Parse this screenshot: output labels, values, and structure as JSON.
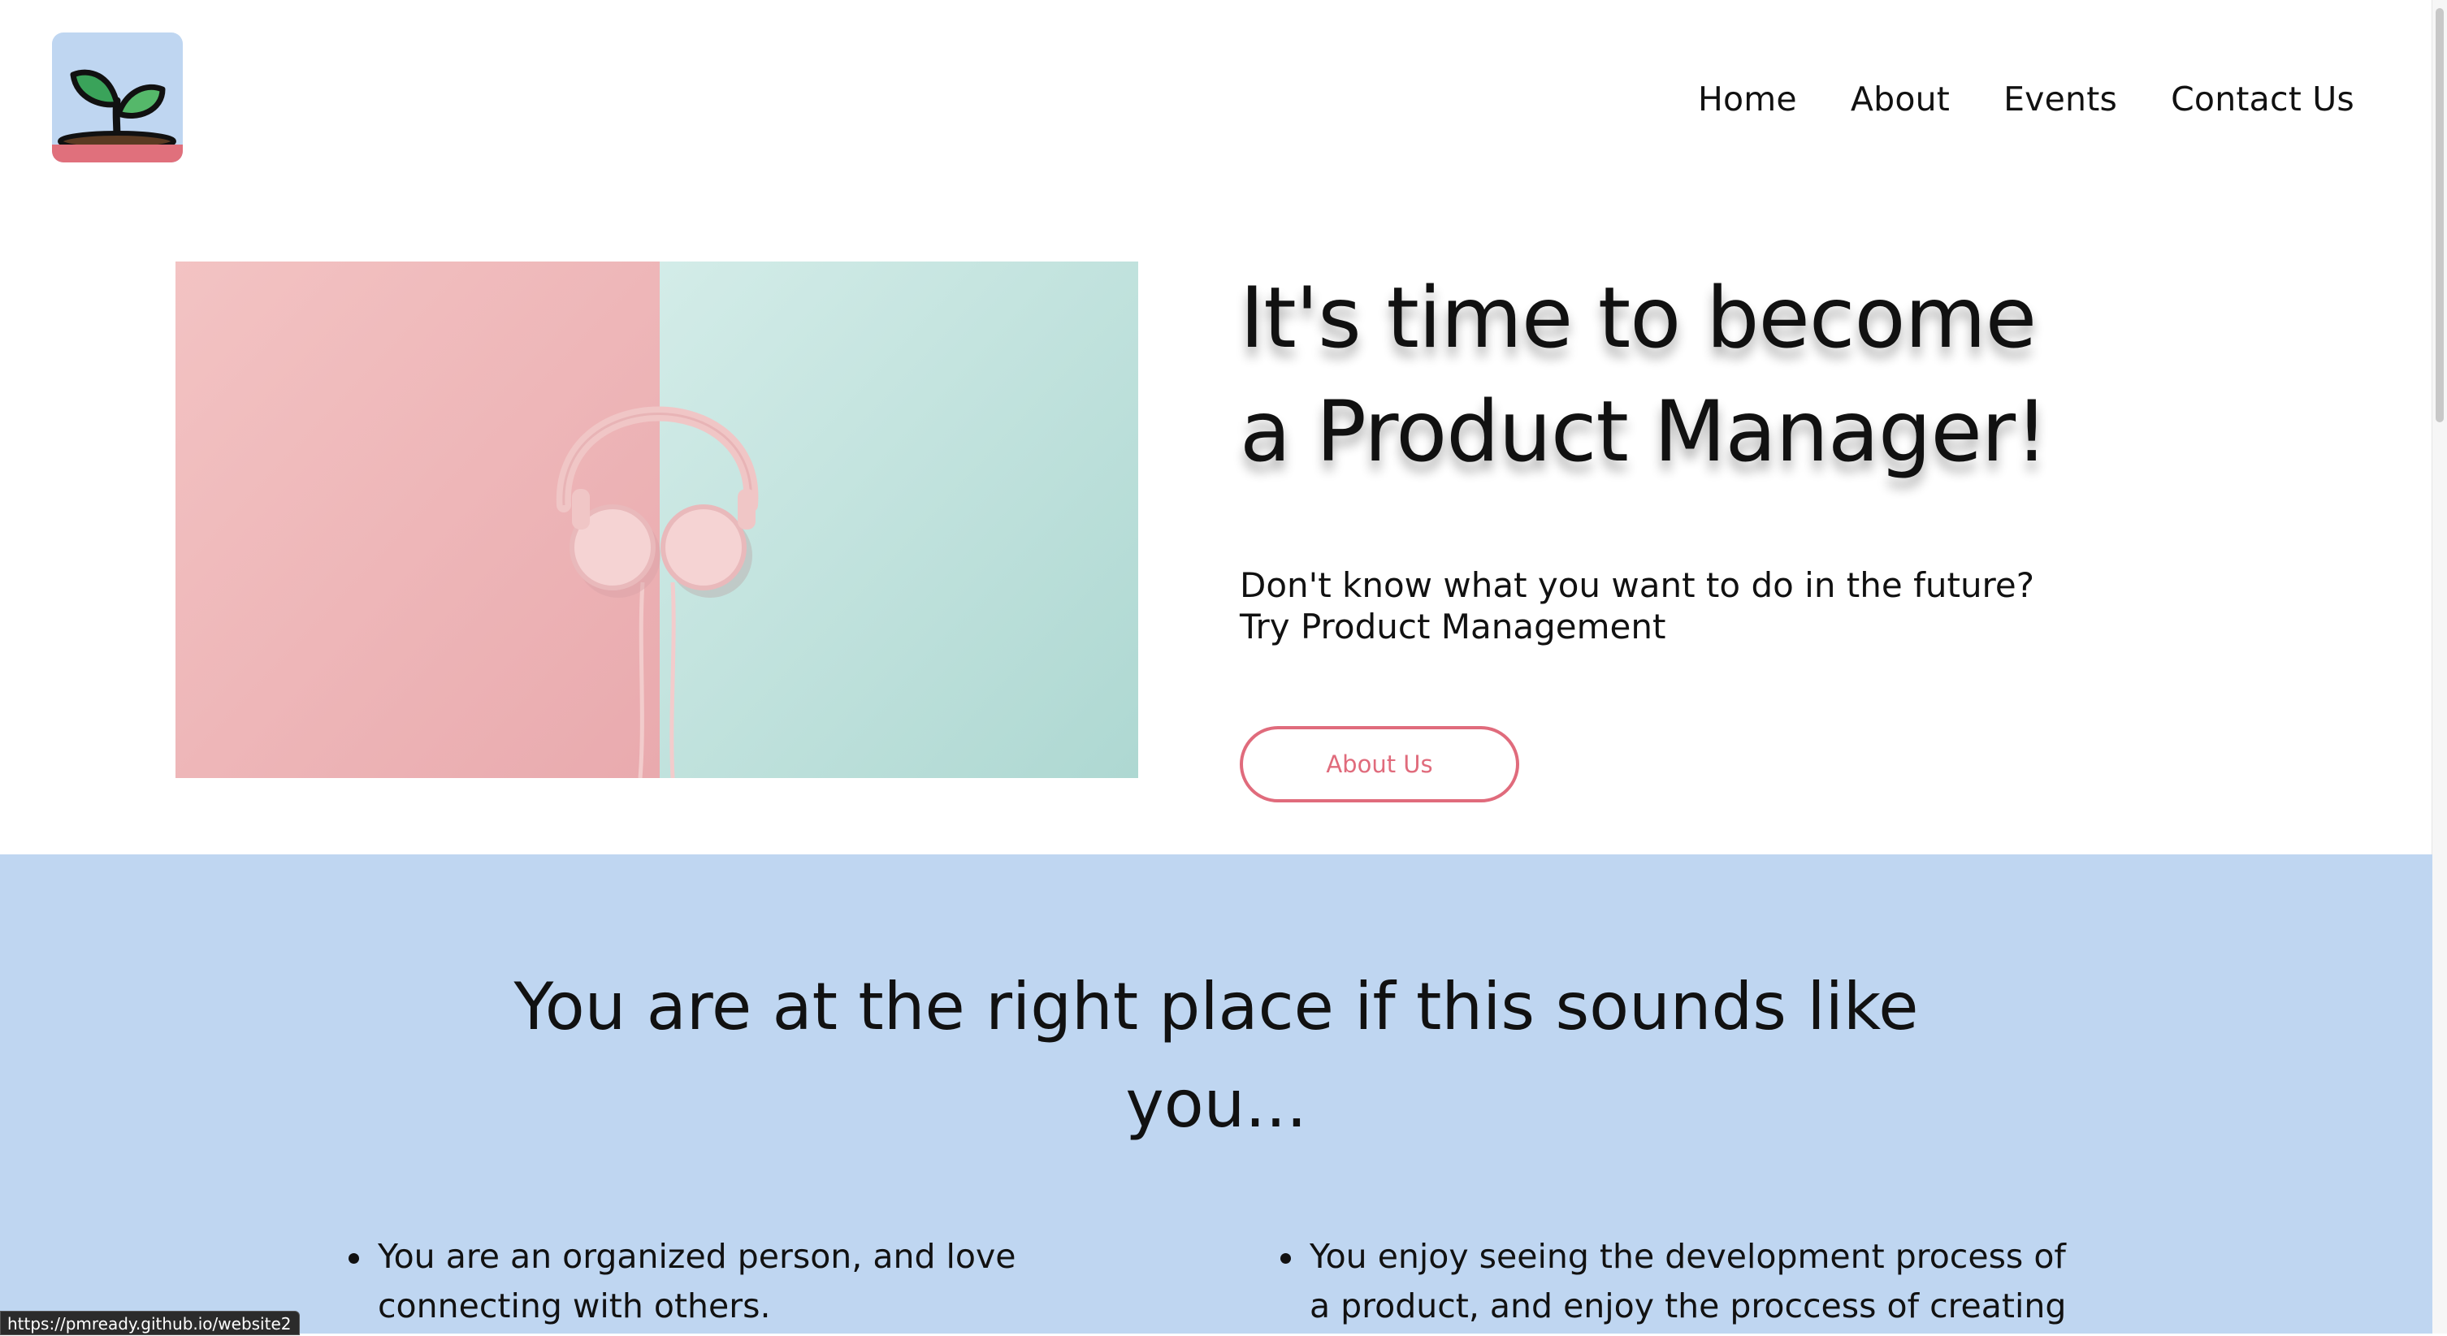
{
  "header": {
    "logo_icon": "sprout-plant-icon",
    "nav": [
      "Home",
      "About",
      "Events",
      "Contact Us"
    ]
  },
  "hero": {
    "image_icon": "headphones-image",
    "title_lines": [
      "It's time to become",
      "a Product Manager!"
    ],
    "subtitle_lines": [
      "Don't know what you want to do in the future?",
      "Try Product Management"
    ],
    "button_label": "About Us"
  },
  "audience": {
    "title_lines": [
      "You are at the right place if this sounds like",
      "you..."
    ],
    "left_bullet_lines": [
      "You are an organized person, and love",
      "connecting with others."
    ],
    "right_bullet_lines": [
      "You enjoy seeing the development process of",
      "a product, and enjoy the proccess of creating"
    ]
  },
  "status_url": "https://pmready.github.io/website2",
  "colors": {
    "accent": "#e06b7c",
    "section_bg": "#bfd6f1",
    "hero_left": "#f2c1c1",
    "hero_right": "#cde8e3"
  }
}
